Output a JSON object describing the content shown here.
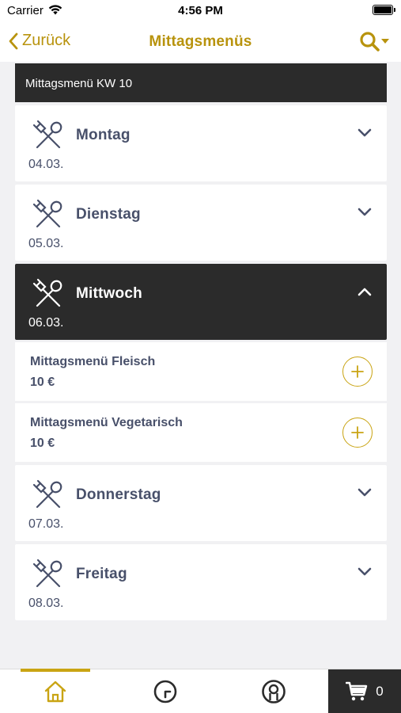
{
  "status_bar": {
    "carrier": "Carrier",
    "time": "4:56 PM"
  },
  "nav": {
    "back_label": "Zurück",
    "title": "Mittagsmenüs",
    "search_icon": "search-dropdown-icon"
  },
  "week_header": "Mittagsmenü KW 10",
  "days": [
    {
      "name": "Montag",
      "date": "04.03.",
      "expanded": false
    },
    {
      "name": "Dienstag",
      "date": "05.03.",
      "expanded": false
    },
    {
      "name": "Mittwoch",
      "date": "06.03.",
      "expanded": true
    },
    {
      "name": "Donnerstag",
      "date": "07.03.",
      "expanded": false
    },
    {
      "name": "Freitag",
      "date": "08.03.",
      "expanded": false
    }
  ],
  "menu_items": [
    {
      "name": "Mittagsmenü Fleisch",
      "price": "10 €"
    },
    {
      "name": "Mittagsmenü Vegetarisch",
      "price": "10 €"
    }
  ],
  "tab_bar": {
    "cart_count": "0",
    "active_tab": "home"
  },
  "colors": {
    "accent": "#c9a413",
    "dark": "#2b2b2b",
    "text": "#48506a",
    "background": "#f1f1f3"
  }
}
